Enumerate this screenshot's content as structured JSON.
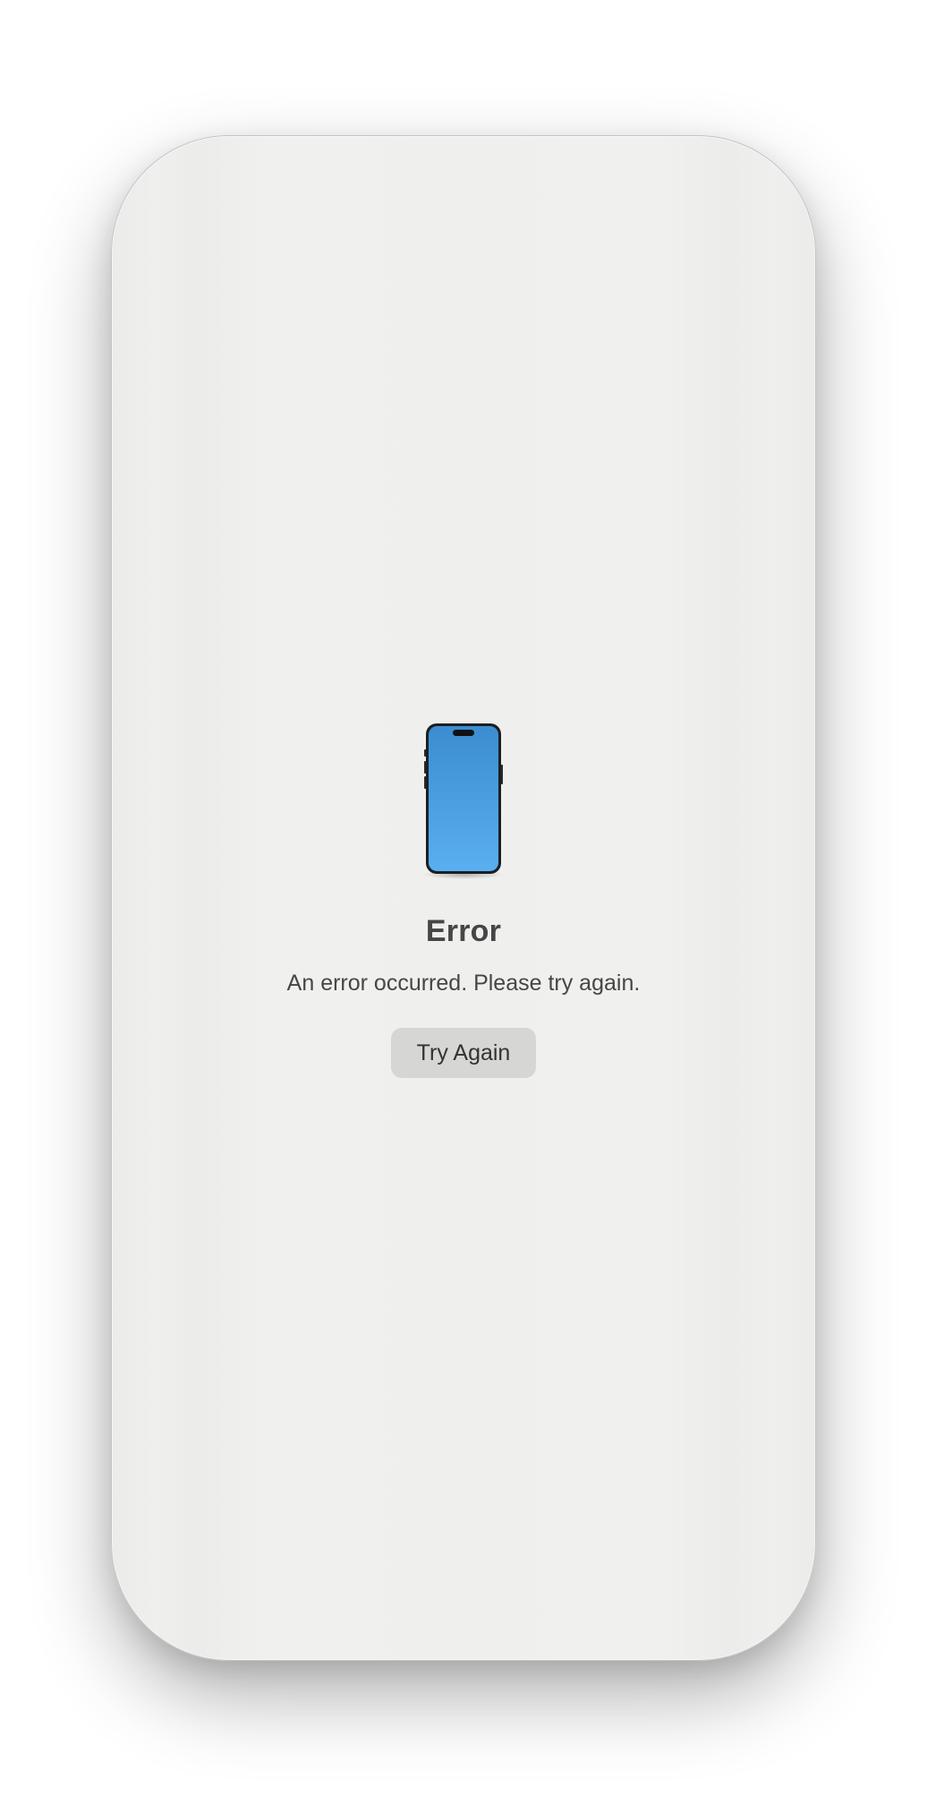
{
  "error_screen": {
    "icon": "iphone-icon",
    "title": "Error",
    "message": "An error occurred. Please try again.",
    "retry_label": "Try Again"
  },
  "colors": {
    "background": "#efefee",
    "text": "#464646",
    "button_bg": "#d6d6d5",
    "phone_screen_top": "#3b8dd0",
    "phone_screen_bottom": "#5aaff0"
  }
}
